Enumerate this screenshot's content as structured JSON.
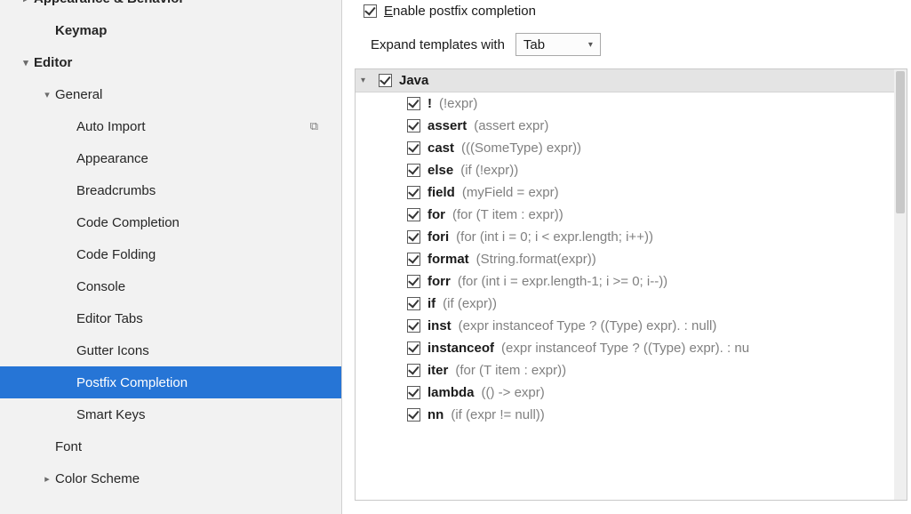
{
  "sidebar": {
    "items": [
      {
        "label": "Appearance & Behavior",
        "level": 0,
        "bold": true,
        "arrow": "right",
        "trailing": ""
      },
      {
        "label": "Keymap",
        "level": 1,
        "bold": true,
        "arrow": "",
        "trailing": ""
      },
      {
        "label": "Editor",
        "level": 0,
        "bold": true,
        "arrow": "down",
        "trailing": ""
      },
      {
        "label": "General",
        "level": 1,
        "bold": false,
        "arrow": "down",
        "trailing": ""
      },
      {
        "label": "Auto Import",
        "level": 2,
        "bold": false,
        "arrow": "",
        "trailing": "⧉"
      },
      {
        "label": "Appearance",
        "level": 2,
        "bold": false,
        "arrow": "",
        "trailing": ""
      },
      {
        "label": "Breadcrumbs",
        "level": 2,
        "bold": false,
        "arrow": "",
        "trailing": ""
      },
      {
        "label": "Code Completion",
        "level": 2,
        "bold": false,
        "arrow": "",
        "trailing": ""
      },
      {
        "label": "Code Folding",
        "level": 2,
        "bold": false,
        "arrow": "",
        "trailing": ""
      },
      {
        "label": "Console",
        "level": 2,
        "bold": false,
        "arrow": "",
        "trailing": ""
      },
      {
        "label": "Editor Tabs",
        "level": 2,
        "bold": false,
        "arrow": "",
        "trailing": ""
      },
      {
        "label": "Gutter Icons",
        "level": 2,
        "bold": false,
        "arrow": "",
        "trailing": ""
      },
      {
        "label": "Postfix Completion",
        "level": 2,
        "bold": false,
        "arrow": "",
        "trailing": "",
        "selected": true
      },
      {
        "label": "Smart Keys",
        "level": 2,
        "bold": false,
        "arrow": "",
        "trailing": ""
      },
      {
        "label": "Font",
        "level": 1,
        "bold": false,
        "arrow": "",
        "trailing": ""
      },
      {
        "label": "Color Scheme",
        "level": 1,
        "bold": false,
        "arrow": "right",
        "trailing": ""
      }
    ]
  },
  "main": {
    "enable_checkbox_checked": true,
    "enable_label_prefix": "E",
    "enable_label_rest": "nable postfix completion",
    "expand_label": "Expand templates with",
    "expand_value": "Tab",
    "group_title": "Java",
    "templates": [
      {
        "key": "!",
        "desc": "(!expr)"
      },
      {
        "key": "assert",
        "desc": "(assert expr)"
      },
      {
        "key": "cast",
        "desc": "(((SomeType) expr))"
      },
      {
        "key": "else",
        "desc": "(if (!expr))"
      },
      {
        "key": "field",
        "desc": "(myField = expr)"
      },
      {
        "key": "for",
        "desc": "(for (T item : expr))"
      },
      {
        "key": "fori",
        "desc": "(for (int i = 0; i < expr.length; i++))"
      },
      {
        "key": "format",
        "desc": "(String.format(expr))"
      },
      {
        "key": "forr",
        "desc": "(for (int i = expr.length-1; i >= 0; i--))"
      },
      {
        "key": "if",
        "desc": "(if (expr))"
      },
      {
        "key": "inst",
        "desc": "(expr instanceof Type ? ((Type) expr). : null)"
      },
      {
        "key": "instanceof",
        "desc": "(expr instanceof Type ? ((Type) expr). : nu"
      },
      {
        "key": "iter",
        "desc": "(for (T item : expr))"
      },
      {
        "key": "lambda",
        "desc": "(() -> expr)"
      },
      {
        "key": "nn",
        "desc": "(if (expr != null))"
      }
    ]
  }
}
